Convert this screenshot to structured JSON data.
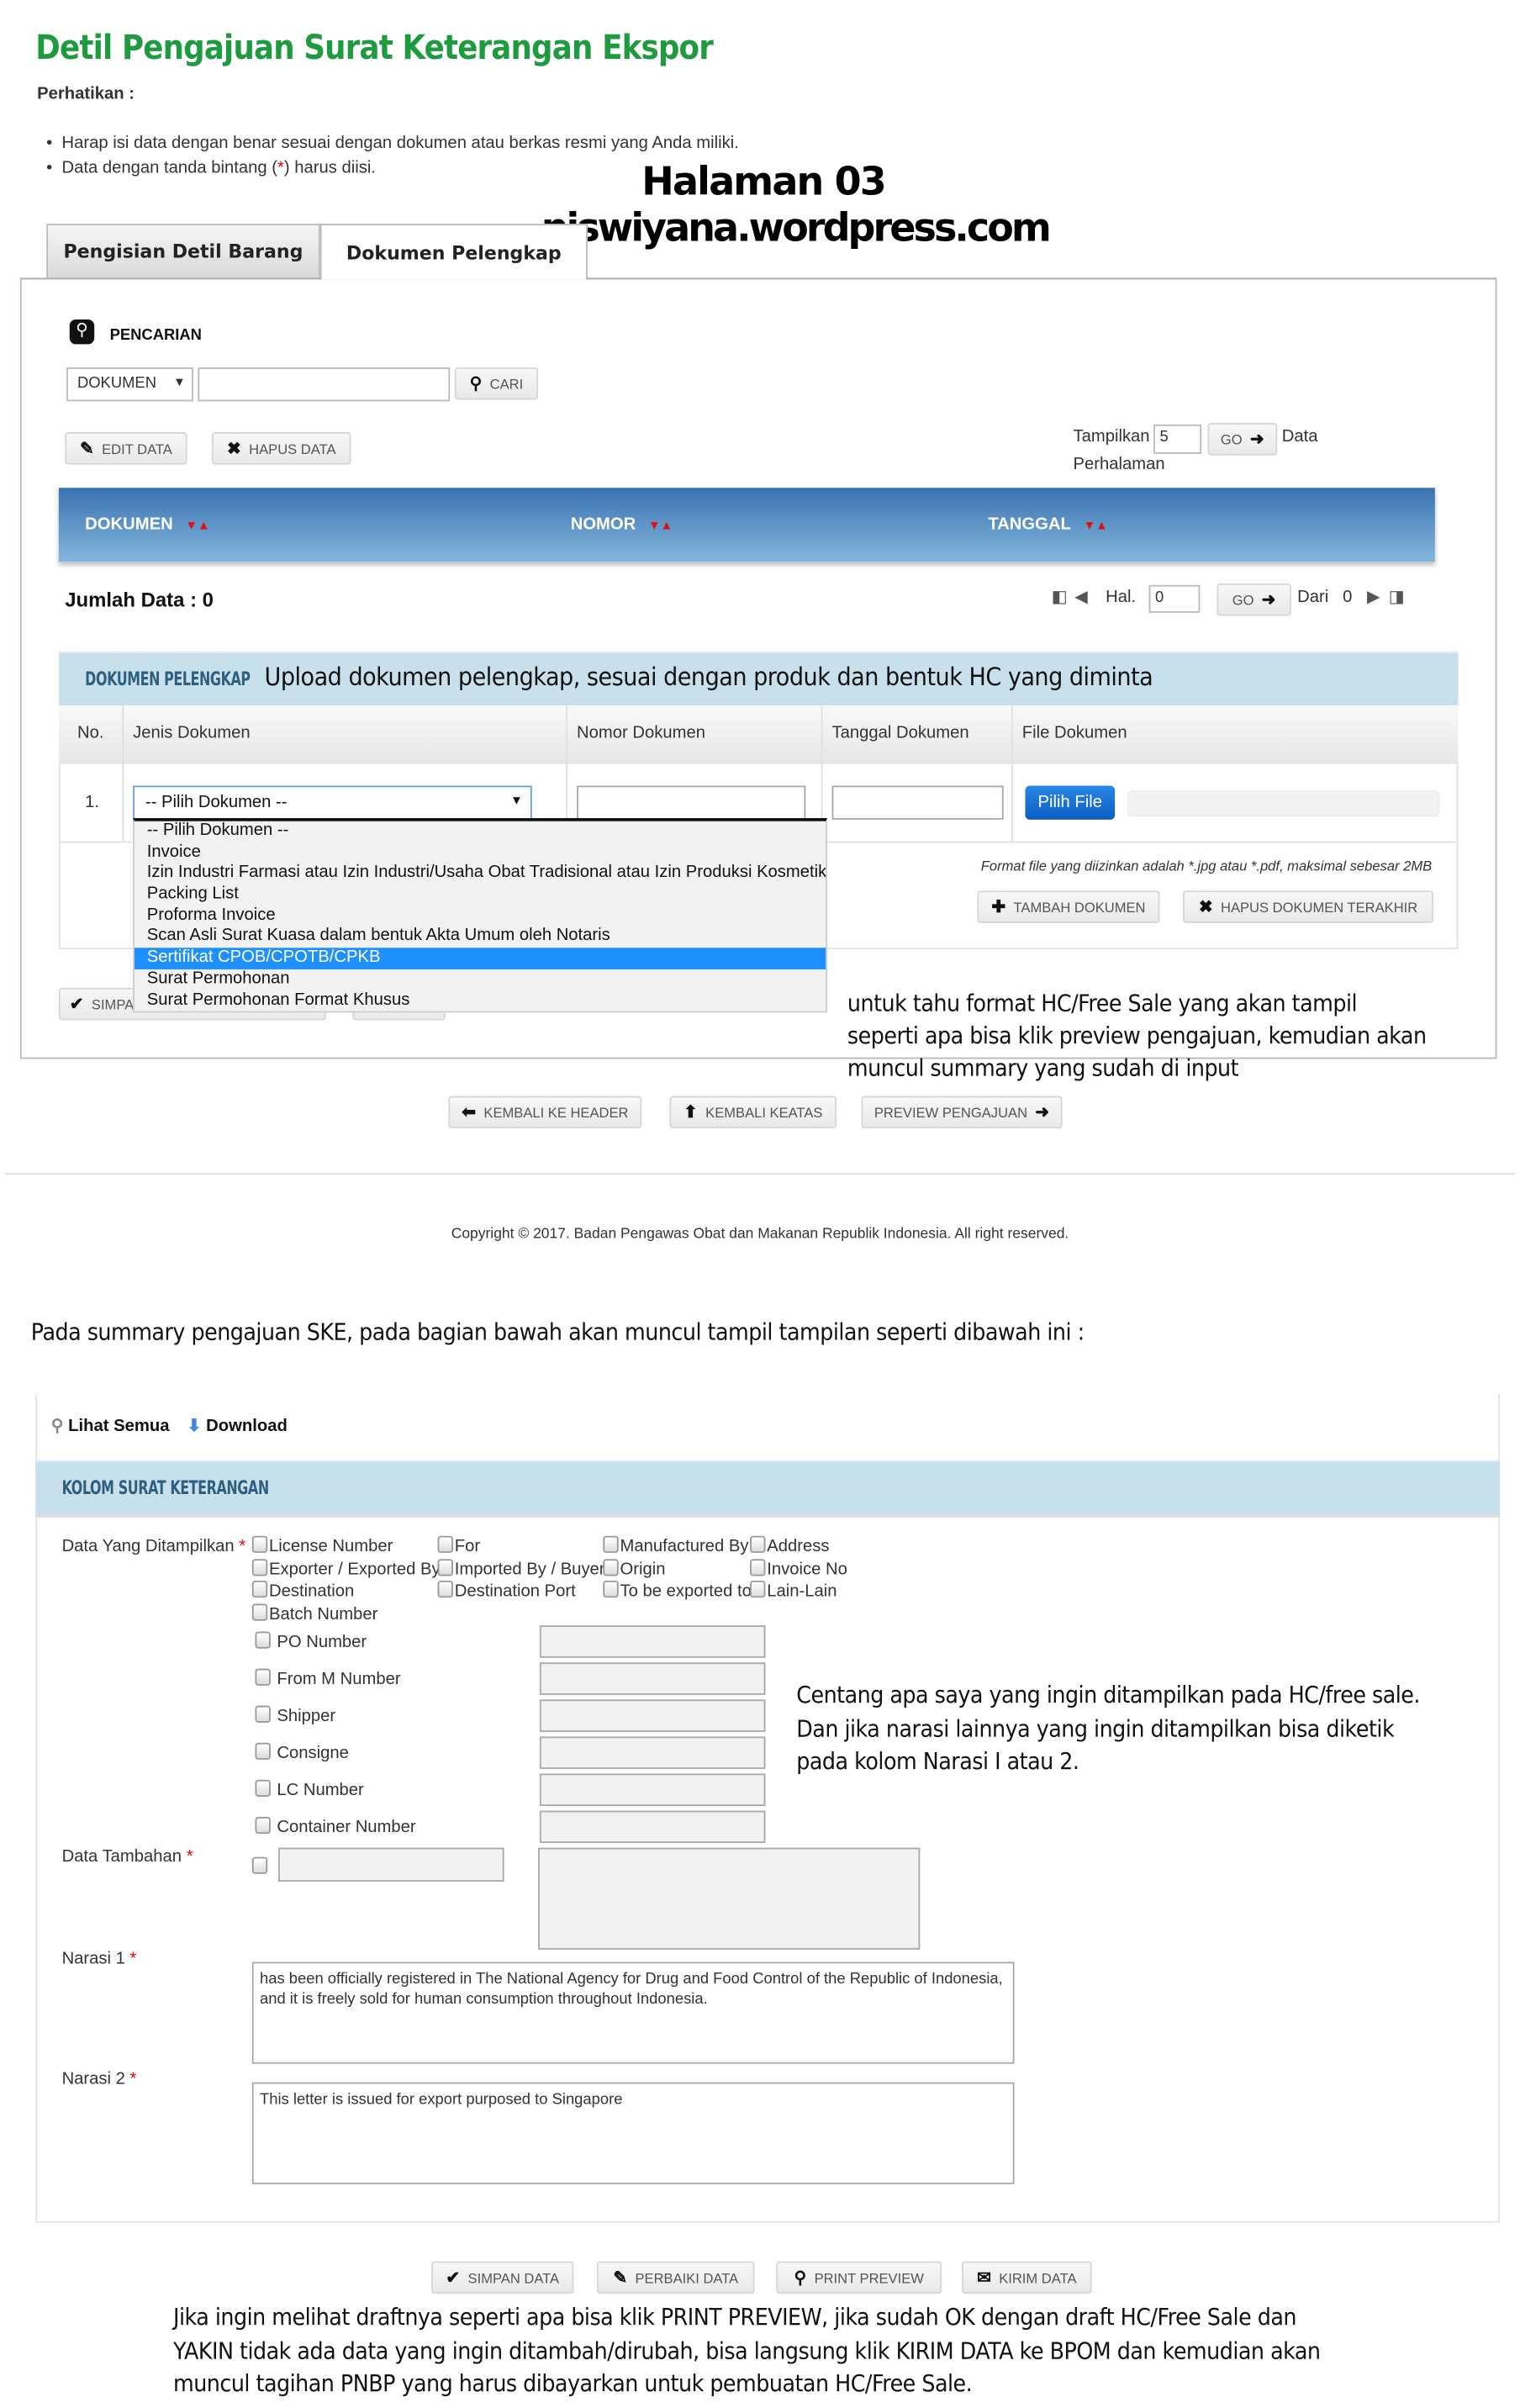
{
  "page": {
    "title": "Detil Pengajuan Surat Keterangan Ekspor",
    "notice_label": "Perhatikan :",
    "notices": [
      "Harap isi data dengan benar sesuai dengan dokumen atau berkas resmi yang Anda miliki.",
      "Data dengan tanda bintang (",
      "*",
      ") harus diisi."
    ]
  },
  "overlay": {
    "page_label": "Halaman 03",
    "site": "niswiyana.wordpress.com",
    "upload_note": "Upload dokumen pelengkap, sesuai dengan produk dan bentuk HC yang diminta",
    "preview_note": [
      "untuk tahu format HC/Free Sale yang akan tampil",
      "seperti apa bisa klik preview pengajuan, kemudian akan",
      "muncul summary yang sudah di input"
    ],
    "summary_note": "Pada summary pengajuan SKE, pada bagian bawah akan muncul tampil tampilan seperti dibawah ini :",
    "checkbox_note": [
      "Centang apa saya yang ingin ditampilkan pada HC/free sale.",
      "Dan jika narasi lainnya yang ingin ditampilkan bisa diketik",
      "pada kolom Narasi I atau 2."
    ],
    "final_note": [
      "Jika ingin melihat draftnya seperti apa bisa klik PRINT PREVIEW, jika sudah OK dengan draft  HC/Free Sale dan",
      "YAKIN tidak ada data yang ingin ditambah/dirubah, bisa langsung klik KIRIM DATA ke BPOM dan kemudian akan",
      "muncul tagihan PNBP yang harus dibayarkan untuk pembuatan HC/Free Sale."
    ]
  },
  "tabs": [
    {
      "label": "Pengisian Detil Barang",
      "active": false
    },
    {
      "label": "Dokumen Pelengkap",
      "active": true
    }
  ],
  "search": {
    "heading": "PENCARIAN",
    "field_select": "DOKUMEN",
    "query": "",
    "search_button": "CARI",
    "edit_button": "EDIT DATA",
    "delete_button": "HAPUS DATA",
    "show_label": "Tampilkan",
    "per_page": "5",
    "go_label": "GO",
    "data_label": "Data",
    "per_page_label": "Perhalaman"
  },
  "grid": {
    "columns": [
      "DOKUMEN",
      "NOMOR",
      "TANGGAL"
    ],
    "total_label": "Jumlah Data : 0",
    "page_label": "Hal.",
    "page_value": "0",
    "go_label": "GO",
    "of_label": "Dari",
    "of_value": "0"
  },
  "dokumen": {
    "heading": "DOKUMEN PELENGKAP",
    "columns": [
      "No.",
      "Jenis Dokumen",
      "Nomor Dokumen",
      "Tanggal Dokumen",
      "File Dokumen"
    ],
    "row_no": "1.",
    "selected": "-- Pilih Dokumen --",
    "nomor": "",
    "tanggal": "",
    "file_button": "Pilih File",
    "options": [
      "-- Pilih Dokumen --",
      "Invoice",
      "Izin Industri Farmasi atau Izin Industri/Usaha Obat Tradisional atau Izin Produksi Kosmetik",
      "Packing List",
      "Proforma Invoice",
      "Scan Asli Surat Kuasa dalam bentuk Akta Umum oleh Notaris",
      "Sertifikat CPOB/CPOTB/CPKB",
      "Surat Permohonan",
      "Surat Permohonan Format Khusus"
    ],
    "highlighted_option": "Sertifikat CPOB/CPOTB/CPKB",
    "format_note": "Format file yang diizinkan adalah *.jpg atau *.pdf, maksimal sebesar 2MB",
    "add_button": "TAMBAH DOKUMEN",
    "remove_button": "HAPUS DOKUMEN TERAKHIR",
    "save_button_partial": "SIMPA"
  },
  "nav_buttons": {
    "back_header": "KEMBALI KE HEADER",
    "back_top": "KEMBALI KEATAS",
    "preview": "PREVIEW PENGAJUAN"
  },
  "footer": {
    "copyright": "Copyright © 2017. Badan Pengawas Obat dan Makanan Republik Indonesia. All right reserved."
  },
  "summary": {
    "view_all": "Lihat Semua",
    "download": "Download",
    "heading": "KOLOM SURAT KETERANGAN",
    "display_label": "Data Yang Ditampilkan",
    "required_mark": "*",
    "checkbox_grid": [
      [
        "License Number",
        "For",
        "Manufactured By",
        "Address"
      ],
      [
        "Exporter / Exported By",
        "Imported By / Buyer",
        "Origin",
        "Invoice No"
      ],
      [
        "Destination",
        "Destination Port",
        "To be exported to",
        "Lain-Lain"
      ],
      [
        "Batch Number"
      ]
    ],
    "numbered_fields": [
      "PO Number",
      "From M Number",
      "Shipper",
      "Consigne",
      "LC Number",
      "Container Number"
    ],
    "extra_label": "Data Tambahan",
    "narasi1_label": "Narasi 1",
    "narasi1": "has been officially registered in The National Agency for Drug and Food Control of the Republic of Indonesia, and it is freely sold for human consumption throughout Indonesia.",
    "narasi2_label": "Narasi 2",
    "narasi2": "This letter is issued for export purposed to Singapore"
  },
  "actions": {
    "save": "SIMPAN DATA",
    "fix": "PERBAIKI DATA",
    "print": "PRINT PREVIEW",
    "send": "KIRIM DATA"
  },
  "colors": {
    "title_green": "#1e9b3e",
    "header_blue": "#3a72b2",
    "section_lightblue": "#c8e0ec",
    "file_button_blue": "#1a73d9",
    "highlight": "#1e90ff"
  }
}
